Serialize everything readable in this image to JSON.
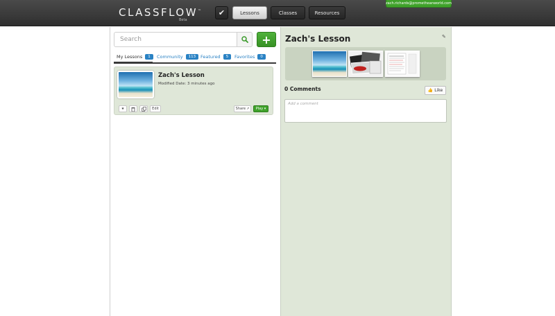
{
  "header": {
    "logo": "CLASSFLOW",
    "logo_tm": "™",
    "logo_sub": "Beta",
    "nav": [
      {
        "label": "Lessons",
        "active": true
      },
      {
        "label": "Classes",
        "active": false
      },
      {
        "label": "Resources",
        "active": false
      }
    ],
    "user_email": "zach.richards@prometheanworld.com"
  },
  "search": {
    "placeholder": "Search"
  },
  "add_button": "+",
  "tabs": [
    {
      "label": "My Lessons",
      "count": "1"
    },
    {
      "label": "Community",
      "count": "113"
    },
    {
      "label": "Featured",
      "count": "5"
    },
    {
      "label": "Favorites",
      "count": "0"
    }
  ],
  "lesson": {
    "title": "Zach's Lesson",
    "modified": "Modified Date: 3 minutes ago",
    "edit_label": "Edit",
    "share_label": "Share",
    "play_label": "Play ▾"
  },
  "detail": {
    "title": "Zach's Lesson",
    "comments_label": "0 Comments",
    "like_label": "Like",
    "comment_placeholder": "Add a comment"
  },
  "colors": {
    "accent_green": "#3fa22a",
    "link_blue": "#2a82c4",
    "panel_green": "#dfe7d8"
  }
}
